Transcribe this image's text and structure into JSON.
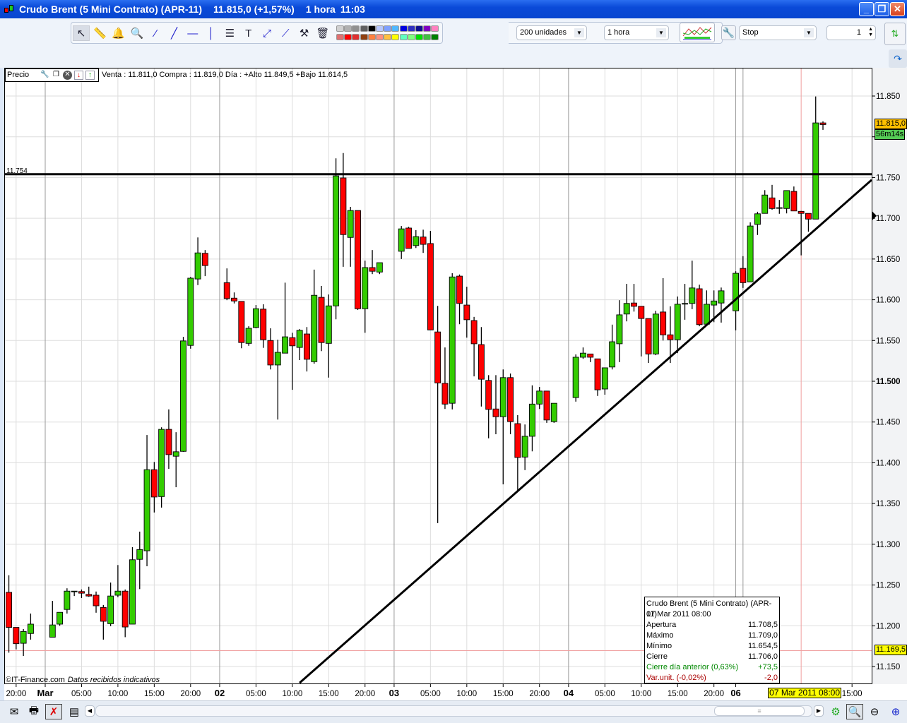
{
  "window": {
    "title": "Crudo Brent (5 Mini Contrato) (APR-11)",
    "price": "11.815,0 (+1,57%)",
    "timeframe": "1 hora",
    "time": "11:03",
    "minimize": "_",
    "restore": "❐",
    "close": "✕"
  },
  "toolbar": {
    "tools": [
      {
        "name": "pointer-icon",
        "glyph": "↖"
      },
      {
        "name": "ruler-icon",
        "glyph": "📏"
      },
      {
        "name": "alarm-bell-icon",
        "glyph": "🔔"
      },
      {
        "name": "zoom-icon",
        "glyph": "🔍"
      },
      {
        "name": "segment-icon",
        "glyph": "⁄"
      },
      {
        "name": "trendline-icon",
        "glyph": "╱"
      },
      {
        "name": "horizontal-line-icon",
        "glyph": "—"
      },
      {
        "name": "vertical-line-icon",
        "glyph": "│"
      },
      {
        "name": "fibonacci-icon",
        "glyph": "☰"
      },
      {
        "name": "text-icon",
        "glyph": "T"
      },
      {
        "name": "parallel-channel-icon",
        "glyph": "⤢"
      },
      {
        "name": "angle-line-icon",
        "glyph": "⟋"
      },
      {
        "name": "tools-icon",
        "glyph": "⚒"
      },
      {
        "name": "trash-icon",
        "glyph": "🗑"
      }
    ],
    "palette_top": [
      "#d0d0d0",
      "#b0b0b0",
      "#909090",
      "#606060",
      "#000000",
      "#b8c8ff",
      "#7fa0ff",
      "#50b8ff",
      "#0000e0",
      "#3030c0",
      "#101090",
      "#8000c0",
      "#ff80c0"
    ],
    "palette_bottom": [
      "#e07070",
      "#ff0000",
      "#e03030",
      "#904010",
      "#ff8040",
      "#ff9080",
      "#ffc040",
      "#ffff00",
      "#60ffc0",
      "#80ff80",
      "#00e000",
      "#40c040",
      "#008000"
    ],
    "units_select": "200 unidades",
    "period_select": "1 hora",
    "order_type_select": "Stop",
    "quantity": "1"
  },
  "info": {
    "label": "Precio",
    "quote": "Venta : 11.811,0 Compra : 11.819,0  Día : +Alto 11.849,5 +Bajo 11.614,5"
  },
  "tooltip": {
    "title": "Crudo Brent (5 Mini Contrato) (APR-11)",
    "date": "07 Mar 2011 08:00",
    "rows": [
      {
        "label": "Apertura",
        "value": "11.708,5"
      },
      {
        "label": "Máximo",
        "value": "11.709,0"
      },
      {
        "label": "Mínimo",
        "value": "11.654,5"
      },
      {
        "label": "Cierre",
        "value": "11.706,0"
      }
    ],
    "prev_close": {
      "label": "Cierre día anterior (0,63%)",
      "value": "+73,5"
    },
    "var_unit": {
      "label": "Var.unit. (-0,02%)",
      "value": "-2,0"
    }
  },
  "credit": {
    "source": "©IT-Finance.com",
    "note": "Datos recibidos indicativos"
  },
  "colors": {
    "up": "#33cc00",
    "down": "#ff0000",
    "last_price_bg": "#ffc000",
    "countdown_bg": "#55cc55",
    "crosshair_bg": "#ffff00",
    "crosshair_line": "#f0a0a0"
  },
  "chart_data": {
    "type": "candlestick",
    "ylim": [
      11130,
      11885
    ],
    "y_ticks": [
      {
        "value": 11850,
        "label": "11.850"
      },
      {
        "value": 11800,
        "label": "11.800"
      },
      {
        "value": 11750,
        "label": "11.750"
      },
      {
        "value": 11700,
        "label": "11.700"
      },
      {
        "value": 11650,
        "label": "11.650"
      },
      {
        "value": 11600,
        "label": "11.600"
      },
      {
        "value": 11550,
        "label": "11.550"
      },
      {
        "value": 11500,
        "label": "11.500",
        "bold": true
      },
      {
        "value": 11450,
        "label": "11.450"
      },
      {
        "value": 11400,
        "label": "11.400"
      },
      {
        "value": 11350,
        "label": "11.350"
      },
      {
        "value": 11300,
        "label": "11.300"
      },
      {
        "value": 11250,
        "label": "11.250"
      },
      {
        "value": 11200,
        "label": "11.200"
      },
      {
        "value": 11150,
        "label": "11.150"
      }
    ],
    "x_ticks": [
      {
        "time": "28 Feb 20:00",
        "label": "20:00"
      },
      {
        "time": "01 Mar 00:00",
        "label": "Mar",
        "bold": true
      },
      {
        "time": "01 Mar 05:00",
        "label": "05:00"
      },
      {
        "time": "01 Mar 10:00",
        "label": "10:00"
      },
      {
        "time": "01 Mar 15:00",
        "label": "15:00"
      },
      {
        "time": "01 Mar 20:00",
        "label": "20:00"
      },
      {
        "time": "02 Mar 00:00",
        "label": "02",
        "bold": true
      },
      {
        "time": "02 Mar 05:00",
        "label": "05:00"
      },
      {
        "time": "02 Mar 10:00",
        "label": "10:00"
      },
      {
        "time": "02 Mar 15:00",
        "label": "15:00"
      },
      {
        "time": "02 Mar 20:00",
        "label": "20:00"
      },
      {
        "time": "03 Mar 00:00",
        "label": "03",
        "bold": true
      },
      {
        "time": "03 Mar 05:00",
        "label": "05:00"
      },
      {
        "time": "03 Mar 10:00",
        "label": "10:00"
      },
      {
        "time": "03 Mar 15:00",
        "label": "15:00"
      },
      {
        "time": "03 Mar 20:00",
        "label": "20:00"
      },
      {
        "time": "04 Mar 00:00",
        "label": "04",
        "bold": true
      },
      {
        "time": "04 Mar 05:00",
        "label": "05:00"
      },
      {
        "time": "04 Mar 10:00",
        "label": "10:00"
      },
      {
        "time": "04 Mar 15:00",
        "label": "15:00"
      },
      {
        "time": "04 Mar 20:00",
        "label": "20:00"
      },
      {
        "time": "06 Mar 23:00",
        "label": "06",
        "bold": true
      },
      {
        "time": "07 Mar 15:00",
        "label": "15:00"
      }
    ],
    "candles_columns": [
      "time",
      "open",
      "high",
      "low",
      "close"
    ],
    "candles": [
      [
        "28 Feb 19:00",
        11241,
        11262,
        11167,
        11198
      ],
      [
        "28 Feb 20:00",
        11198,
        11198,
        11171,
        11178
      ],
      [
        "28 Feb 21:00",
        11178.5,
        11196,
        11163,
        11193
      ],
      [
        "28 Feb 22:00",
        11190.5,
        11215,
        11183,
        11202
      ],
      [
        "01 Mar 01:00",
        11186,
        11230.5,
        11186,
        11201
      ],
      [
        "01 Mar 02:00",
        11202,
        11216.5,
        11200,
        11216.5
      ],
      [
        "01 Mar 03:00",
        11220,
        11246,
        11215,
        11242.5
      ],
      [
        "01 Mar 04:00",
        11242.5,
        11242.5,
        11236.5,
        11242.5
      ],
      [
        "01 Mar 05:00",
        11242,
        11244.5,
        11234,
        11240
      ],
      [
        "01 Mar 06:00",
        11238.5,
        11248,
        11235.5,
        11236.5
      ],
      [
        "01 Mar 07:00",
        11237.5,
        11242,
        11216,
        11224.5
      ],
      [
        "01 Mar 08:00",
        11222.5,
        11225.5,
        11183,
        11205.5
      ],
      [
        "01 Mar 09:00",
        11202.5,
        11253,
        11199.5,
        11236.5
      ],
      [
        "01 Mar 10:00",
        11237.5,
        11274.5,
        11235,
        11242.5
      ],
      [
        "01 Mar 11:00",
        11242.5,
        11244.5,
        11186,
        11198.5
      ],
      [
        "01 Mar 12:00",
        11202,
        11296.5,
        11202,
        11281
      ],
      [
        "01 Mar 13:00",
        11281.5,
        11315.5,
        11245,
        11293.5
      ],
      [
        "01 Mar 14:00",
        11292,
        11434,
        11273,
        11391.5
      ],
      [
        "01 Mar 15:00",
        11391.5,
        11401,
        11339,
        11358
      ],
      [
        "01 Mar 16:00",
        11358.5,
        11443.5,
        11345,
        11441
      ],
      [
        "01 Mar 17:00",
        11441,
        11465.5,
        11392.5,
        11410
      ],
      [
        "01 Mar 18:00",
        11408,
        11437.5,
        11370,
        11413.5
      ],
      [
        "01 Mar 19:00",
        11414,
        11554.5,
        11413.5,
        11549.5
      ],
      [
        "01 Mar 20:00",
        11544,
        11628,
        11540,
        11626.5
      ],
      [
        "01 Mar 21:00",
        11625.5,
        11676.5,
        11618,
        11657.5
      ],
      [
        "01 Mar 22:00",
        11657,
        11661,
        11629,
        11642
      ],
      [
        "02 Mar 01:00",
        11621,
        11638.5,
        11599.5,
        11601.5
      ],
      [
        "02 Mar 02:00",
        11602,
        11609,
        11595.5,
        11598.5
      ],
      [
        "02 Mar 03:00",
        11598,
        11598,
        11540.5,
        11547.5
      ],
      [
        "02 Mar 04:00",
        11546.5,
        11567.5,
        11543.5,
        11565
      ],
      [
        "02 Mar 05:00",
        11566,
        11593.5,
        11565,
        11589
      ],
      [
        "02 Mar 06:00",
        11588.5,
        11594.5,
        11541,
        11551
      ],
      [
        "02 Mar 07:00",
        11550,
        11565,
        11514.5,
        11520
      ],
      [
        "02 Mar 08:00",
        11520,
        11551,
        11453,
        11535.5
      ],
      [
        "02 Mar 09:00",
        11534.5,
        11621,
        11534.5,
        11554.5
      ],
      [
        "02 Mar 10:00",
        11553.5,
        11559.5,
        11489.5,
        11543.5
      ],
      [
        "02 Mar 11:00",
        11541.5,
        11564,
        11526,
        11562.5
      ],
      [
        "02 Mar 12:00",
        11558,
        11566.5,
        11512,
        11527
      ],
      [
        "02 Mar 13:00",
        11524,
        11637,
        11521.5,
        11605.5
      ],
      [
        "02 Mar 14:00",
        11603,
        11617,
        11537,
        11547.5
      ],
      [
        "02 Mar 15:00",
        11546.5,
        11606.5,
        11504.5,
        11592.5
      ],
      [
        "02 Mar 16:00",
        11592.5,
        11773.5,
        11576,
        11752
      ],
      [
        "02 Mar 17:00",
        11749.5,
        11780,
        11640.5,
        11680
      ],
      [
        "02 Mar 18:00",
        11676.5,
        11714,
        11640.5,
        11709.5
      ],
      [
        "02 Mar 19:00",
        11709.5,
        11709.5,
        11587.5,
        11589
      ],
      [
        "02 Mar 20:00",
        11589,
        11648,
        11559.5,
        11639.5
      ],
      [
        "02 Mar 21:00",
        11639.5,
        11661,
        11631.5,
        11635
      ],
      [
        "02 Mar 22:00",
        11634,
        11645.5,
        11631.5,
        11645.5
      ],
      [
        "03 Mar 01:00",
        11659.5,
        11690.5,
        11650,
        11687
      ],
      [
        "03 Mar 02:00",
        11688,
        11689.5,
        11663,
        11663
      ],
      [
        "03 Mar 03:00",
        11666.5,
        11685.5,
        11663.5,
        11677.5
      ],
      [
        "03 Mar 04:00",
        11677,
        11686,
        11657.5,
        11668
      ],
      [
        "03 Mar 05:00",
        11669,
        11684.5,
        11563,
        11563
      ],
      [
        "03 Mar 06:00",
        11560.5,
        11592.5,
        11326,
        11498
      ],
      [
        "03 Mar 07:00",
        11497.5,
        11541.5,
        11466,
        11472
      ],
      [
        "03 Mar 08:00",
        11473,
        11632.5,
        11465.5,
        11628
      ],
      [
        "03 Mar 09:00",
        11629,
        11631,
        11570,
        11595.5
      ],
      [
        "03 Mar 10:00",
        11593.5,
        11616,
        11553.5,
        11575.5
      ],
      [
        "03 Mar 11:00",
        11574.5,
        11579,
        11506,
        11546
      ],
      [
        "03 Mar 12:00",
        11545,
        11566.5,
        11469,
        11502.5
      ],
      [
        "03 Mar 13:00",
        11501,
        11507.5,
        11430,
        11465.5
      ],
      [
        "03 Mar 14:00",
        11466,
        11507.5,
        11435,
        11456.5
      ],
      [
        "03 Mar 15:00",
        11456.5,
        11514.5,
        11373.5,
        11504.5
      ],
      [
        "03 Mar 16:00",
        11504.5,
        11509.5,
        11435,
        11450.5
      ],
      [
        "03 Mar 17:00",
        11448,
        11458.5,
        11365.5,
        11406.5
      ],
      [
        "03 Mar 18:00",
        11407,
        11447,
        11391,
        11432.5
      ],
      [
        "03 Mar 19:00",
        11432.5,
        11495,
        11414,
        11472
      ],
      [
        "03 Mar 20:00",
        11472,
        11493,
        11466,
        11488
      ],
      [
        "03 Mar 21:00",
        11488,
        11488,
        11449,
        11452.5
      ],
      [
        "03 Mar 22:00",
        11450.5,
        11473,
        11449,
        11473
      ],
      [
        "04 Mar 01:00",
        11480,
        11533,
        11475,
        11529.5
      ],
      [
        "04 Mar 02:00",
        11529.5,
        11541.5,
        11527.5,
        11534.5
      ],
      [
        "04 Mar 03:00",
        11533.5,
        11533.5,
        11523.5,
        11529.5
      ],
      [
        "04 Mar 04:00",
        11527.5,
        11527.5,
        11482,
        11489.5
      ],
      [
        "04 Mar 05:00",
        11490.5,
        11516.5,
        11483.5,
        11516.5
      ],
      [
        "04 Mar 06:00",
        11517.5,
        11569.5,
        11514.5,
        11548.5
      ],
      [
        "04 Mar 07:00",
        11546,
        11599.5,
        11523.5,
        11581.5
      ],
      [
        "04 Mar 08:00",
        11582.5,
        11619.5,
        11573.5,
        11595.5
      ],
      [
        "04 Mar 09:00",
        11596,
        11619.5,
        11585.5,
        11592
      ],
      [
        "04 Mar 10:00",
        11592,
        11592,
        11530.5,
        11577
      ],
      [
        "04 Mar 11:00",
        11577,
        11577,
        11522.5,
        11533.5
      ],
      [
        "04 Mar 12:00",
        11533.5,
        11586.5,
        11532,
        11582.5
      ],
      [
        "04 Mar 13:00",
        11585,
        11626.5,
        11550,
        11557
      ],
      [
        "04 Mar 14:00",
        11557,
        11592,
        11522.5,
        11551
      ],
      [
        "04 Mar 15:00",
        11551,
        11604,
        11534.5,
        11594.5
      ],
      [
        "04 Mar 16:00",
        11595.5,
        11619.5,
        11575.5,
        11595.5
      ],
      [
        "04 Mar 17:00",
        11595.5,
        11648,
        11588.5,
        11614.5
      ],
      [
        "04 Mar 18:00",
        11613.5,
        11618.5,
        11567.5,
        11569.5
      ],
      [
        "04 Mar 19:00",
        11570,
        11611.5,
        11570,
        11594.5
      ],
      [
        "04 Mar 20:00",
        11593.5,
        11611.5,
        11572.5,
        11598.5
      ],
      [
        "04 Mar 21:00",
        11596,
        11615,
        11572,
        11611
      ],
      [
        "06 Mar 23:00",
        11586.5,
        11635,
        11562.5,
        11632.5
      ],
      [
        "07 Mar 00:00",
        11638.5,
        11653.5,
        11614.5,
        11621
      ],
      [
        "07 Mar 01:00",
        11622,
        11695,
        11622,
        11690.5
      ],
      [
        "07 Mar 02:00",
        11692.5,
        11708,
        11679.5,
        11705.5
      ],
      [
        "07 Mar 03:00",
        11706,
        11734.5,
        11706,
        11728.5
      ],
      [
        "07 Mar 04:00",
        11725,
        11741,
        11710.5,
        11712
      ],
      [
        "07 Mar 05:00",
        11713,
        11722.5,
        11705.5,
        11713
      ],
      [
        "07 Mar 06:00",
        11712,
        11734,
        11706,
        11734
      ],
      [
        "07 Mar 07:00",
        11733,
        11739,
        11709,
        11709
      ],
      [
        "07 Mar 08:00",
        11708.5,
        11709,
        11654.5,
        11706
      ],
      [
        "07 Mar 09:00",
        11706,
        11706,
        11683.5,
        11699
      ],
      [
        "07 Mar 10:00",
        11699,
        11849.5,
        11699,
        11817
      ],
      [
        "07 Mar 11:00",
        11817,
        11819,
        11808.5,
        11815
      ]
    ],
    "horizontal_line": {
      "price": 11754,
      "label": "11.754"
    },
    "trendline": {
      "from": {
        "time": "02 Mar 11:00",
        "price": 11130
      },
      "through": {
        "time": "07 Mar 08:00",
        "price": 11671
      }
    },
    "last_price": {
      "price": 11815,
      "label": "11.815,0",
      "countdown": "56m14s"
    },
    "crosshair": {
      "time": "07 Mar 08:00",
      "price": 11169.5,
      "price_label": "11.169,5",
      "time_label": "07 Mar 2011 08:00"
    }
  },
  "bottombar": {
    "icons": [
      "envelope-icon",
      "printer-icon",
      "crosshair-off-icon",
      "sheet-icon"
    ],
    "scroll_thumb": "≡"
  }
}
